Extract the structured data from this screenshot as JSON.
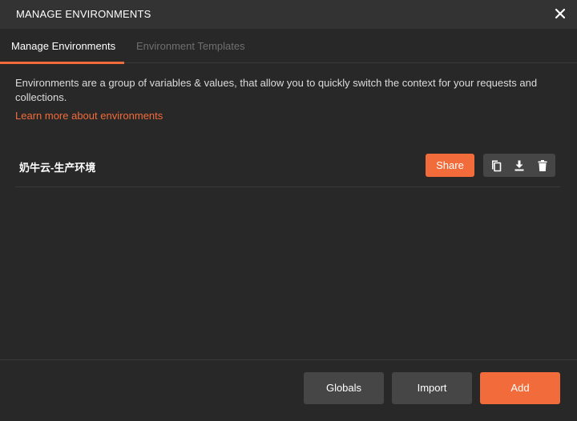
{
  "header": {
    "title": "MANAGE ENVIRONMENTS",
    "close_icon": "close-icon"
  },
  "tabs": [
    {
      "label": "Manage Environments",
      "active": true
    },
    {
      "label": "Environment Templates",
      "active": false
    }
  ],
  "main": {
    "description": "Environments are a group of variables & values, that allow you to quickly switch the context for your requests and collections.",
    "learn_link": "Learn more about environments",
    "environments": [
      {
        "name": "奶牛云-生产环境",
        "share_label": "Share",
        "actions": [
          "duplicate-icon",
          "download-icon",
          "trash-icon"
        ]
      }
    ]
  },
  "footer": {
    "globals_label": "Globals",
    "import_label": "Import",
    "add_label": "Add"
  },
  "colors": {
    "accent": "#f26b3a",
    "background": "#282828",
    "header_background": "#333333",
    "secondary_button": "#464646"
  }
}
